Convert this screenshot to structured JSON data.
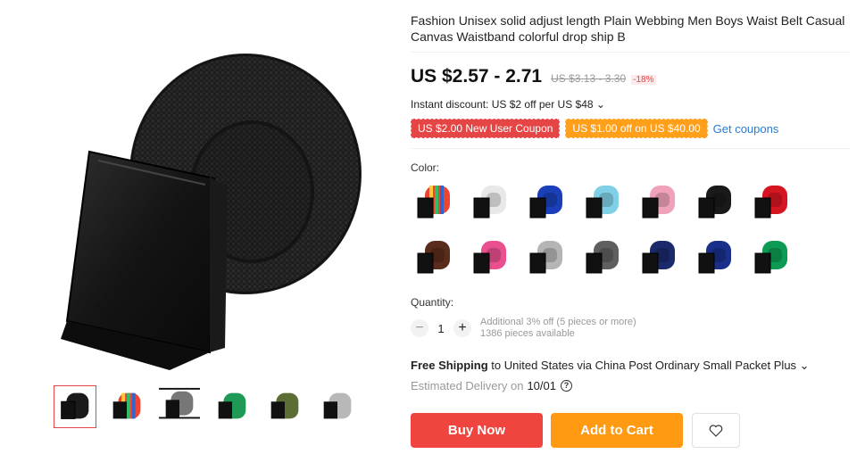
{
  "product": {
    "title": "Fashion Unisex solid adjust length Plain Webbing Men Boys Waist Belt Casual Canvas Waistband colorful drop ship B",
    "price": "US $2.57 - 2.71",
    "old_price": "US $3.13 - 3.30",
    "discount": "-18%",
    "instant_discount": "Instant discount: US $2 off per US $48 ⌄",
    "coupons": [
      "US $2.00 New User Coupon",
      "US $1.00 off on US $40.00"
    ],
    "get_coupons": "Get coupons"
  },
  "gallery": {
    "main_icon": "belt-photo",
    "thumbnails": [
      {
        "color": "#1a1a1a",
        "accent": "#1a1a1a"
      },
      {
        "color": "#1a1a1a",
        "accent": "rainbow"
      },
      {
        "color": "#777777",
        "accent": "#777777"
      },
      {
        "color": "#1e9a56",
        "accent": "#1e9a56"
      },
      {
        "color": "#5c6e33",
        "accent": "#5c6e33"
      },
      {
        "color": "#b8b8b8",
        "accent": "#b8b8b8"
      }
    ]
  },
  "color_section": {
    "label": "Color:",
    "swatches": [
      {
        "color": "rainbow"
      },
      {
        "color": "#e8e8e8"
      },
      {
        "color": "#1b3fb8"
      },
      {
        "color": "#7fd0e6"
      },
      {
        "color": "#f0a3b8"
      },
      {
        "color": "#1a1a1a"
      },
      {
        "color": "#d5151f"
      },
      {
        "color": "#5a2c1c"
      },
      {
        "color": "#ea4f8e"
      },
      {
        "color": "#b5b5b5"
      },
      {
        "color": "#5f5f5f"
      },
      {
        "color": "#1b2a6b"
      },
      {
        "color": "#1a2f8a"
      },
      {
        "color": "#0d9a52"
      }
    ]
  },
  "quantity": {
    "label": "Quantity:",
    "value": "1",
    "minus": "−",
    "plus": "+",
    "offer": "Additional 3% off (5 pieces or more)",
    "available": "1386 pieces available"
  },
  "shipping": {
    "free": "Free Shipping",
    "rest": " to United States via China Post Ordinary Small Packet Plus ⌄",
    "estimated_label": "Estimated Delivery on",
    "date": "10/01",
    "help": "?"
  },
  "actions": {
    "buy_now": "Buy Now",
    "add_to_cart": "Add to Cart",
    "wishlist_icon": "heart-icon"
  }
}
